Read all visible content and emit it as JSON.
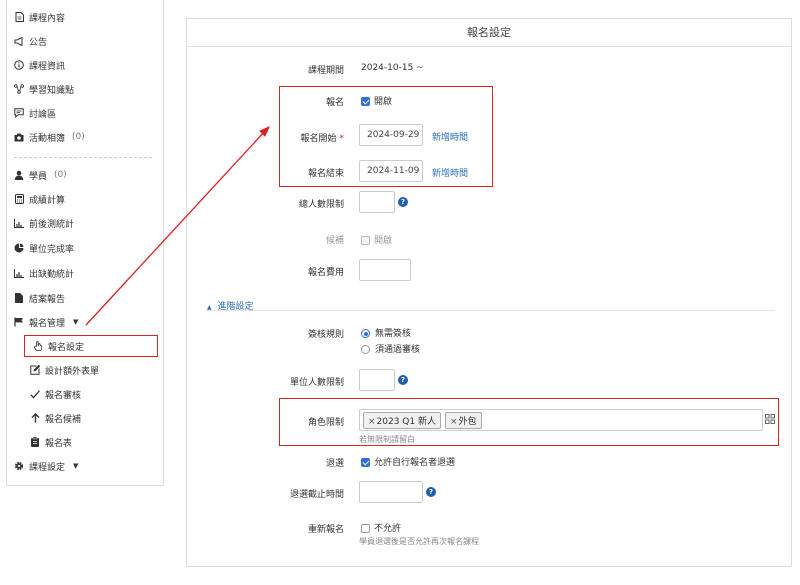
{
  "sidebar": {
    "items": [
      {
        "label": "課程內容",
        "icon": "file-icon"
      },
      {
        "label": "公告",
        "icon": "megaphone-icon"
      },
      {
        "label": "課程資訊",
        "icon": "info-icon"
      },
      {
        "label": "學習知識點",
        "icon": "share-nodes-icon"
      },
      {
        "label": "討論區",
        "icon": "chat-icon"
      },
      {
        "label": "活動相簿",
        "count": "(0)",
        "icon": "camera-icon"
      },
      {
        "label": "學員",
        "count": "(0)",
        "icon": "user-icon"
      },
      {
        "label": "成績計算",
        "icon": "calculator-icon"
      },
      {
        "label": "前後測統計",
        "icon": "bar-chart-icon"
      },
      {
        "label": "單位完成率",
        "icon": "pie-chart-icon"
      },
      {
        "label": "出缺勤統計",
        "icon": "bar-chart-icon"
      },
      {
        "label": "結案報告",
        "icon": "document-icon"
      },
      {
        "label": "報名管理",
        "icon": "flag-icon"
      }
    ],
    "sub_items": [
      {
        "label": "報名設定",
        "icon": "hand-pointer-icon"
      },
      {
        "label": "設計額外表單",
        "icon": "edit-icon"
      },
      {
        "label": "報名審核",
        "icon": "check-icon"
      },
      {
        "label": "報名候補",
        "icon": "arrow-up-icon"
      },
      {
        "label": "報名表",
        "icon": "clipboard-icon"
      }
    ],
    "course_settings": {
      "label": "課程設定",
      "icon": "gear-icon"
    }
  },
  "panel": {
    "title": "報名設定",
    "course_period": {
      "label": "課程期間",
      "value": "2024-10-15 ~"
    },
    "registration": {
      "label": "報名",
      "option": "開啟"
    },
    "reg_start": {
      "label": "報名開始",
      "required_mark": "*",
      "value": "2024-09-29",
      "link": "新增時間"
    },
    "reg_end": {
      "label": "報名結束",
      "value": "2024-11-09",
      "link": "新增時間"
    },
    "total_limit": {
      "label": "總人數限制",
      "value": ""
    },
    "waitlist": {
      "label": "候補",
      "option": "開啟"
    },
    "fee": {
      "label": "報名費用",
      "value": ""
    },
    "advanced_link": "進階設定",
    "review_rule": {
      "label": "簽核規則",
      "options": [
        "無需簽核",
        "須通過審核"
      ]
    },
    "unit_limit": {
      "label": "單位人數限制",
      "value": ""
    },
    "role_limit": {
      "label": "角色限制",
      "tags": [
        "2023 Q1 新人",
        "外包"
      ],
      "hint": "若無限制請留白"
    },
    "withdraw": {
      "label": "退選",
      "option": "允許自行報名者退選"
    },
    "withdraw_deadline": {
      "label": "退選截止時間",
      "value": ""
    },
    "re_register": {
      "label": "重新報名",
      "option": "不允許",
      "hint": "學員退選後是否允許再次報名課程"
    }
  },
  "colors": {
    "accent": "#2f6fd6",
    "link": "#2a6ebb",
    "highlight": "#dd2222"
  }
}
